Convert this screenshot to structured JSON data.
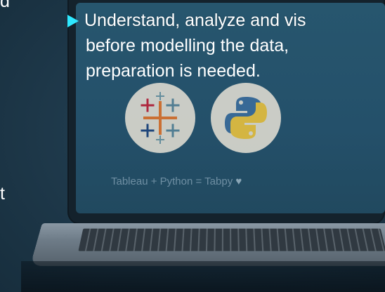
{
  "slide": {
    "bullet_text": "Understand, analyze and vis",
    "continuation_line_1": "before modelling the data,",
    "continuation_line_2": "preparation is needed.",
    "left_fragment_top": "d",
    "left_fragment_bottom": "t"
  },
  "screen": {
    "caption": "Tableau + Python = Tabpy",
    "caption_icon": "heart-icon",
    "logos": [
      "tableau-logo",
      "python-logo"
    ]
  },
  "colors": {
    "arrow": "#2ee8ff",
    "text": "#ffffff",
    "screen": "#24506a",
    "background": "#1e3646"
  }
}
